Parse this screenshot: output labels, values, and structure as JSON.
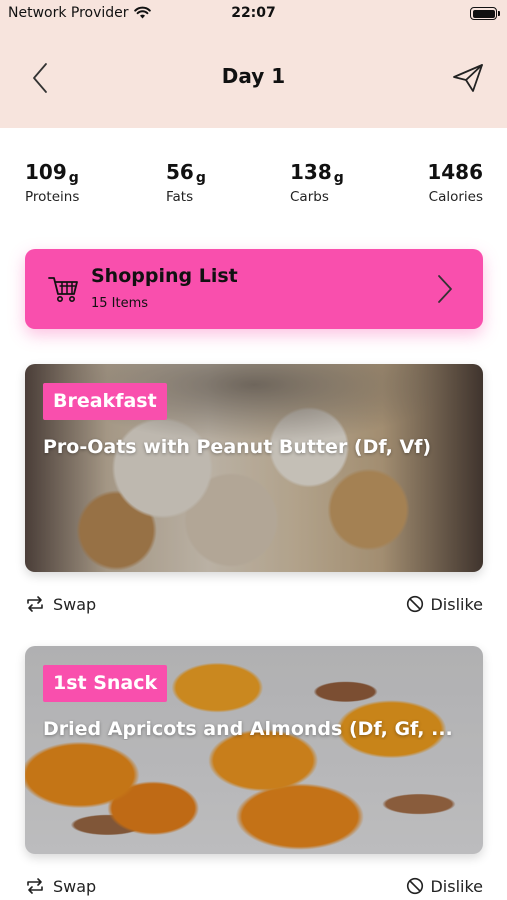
{
  "status_bar": {
    "carrier": "Network Provider",
    "time": "22:07"
  },
  "header": {
    "title": "Day 1"
  },
  "macros": [
    {
      "value": "109",
      "unit": "g",
      "label": "Proteins"
    },
    {
      "value": "56",
      "unit": "g",
      "label": "Fats"
    },
    {
      "value": "138",
      "unit": "g",
      "label": "Carbs"
    },
    {
      "value": "1486",
      "unit": "",
      "label": "Calories"
    }
  ],
  "shopping_list": {
    "title": "Shopping List",
    "count": "15 Items"
  },
  "meals": [
    {
      "tag": "Breakfast",
      "name": "Pro-Oats with Peanut Butter (Df, Vf)",
      "swap": "Swap",
      "dislike": "Dislike"
    },
    {
      "tag": "1st Snack",
      "name": "Dried Apricots and Almonds (Df, Gf, ...",
      "swap": "Swap",
      "dislike": "Dislike"
    }
  ],
  "colors": {
    "accent": "#f94fad",
    "header_bg": "#f7e4dd"
  }
}
